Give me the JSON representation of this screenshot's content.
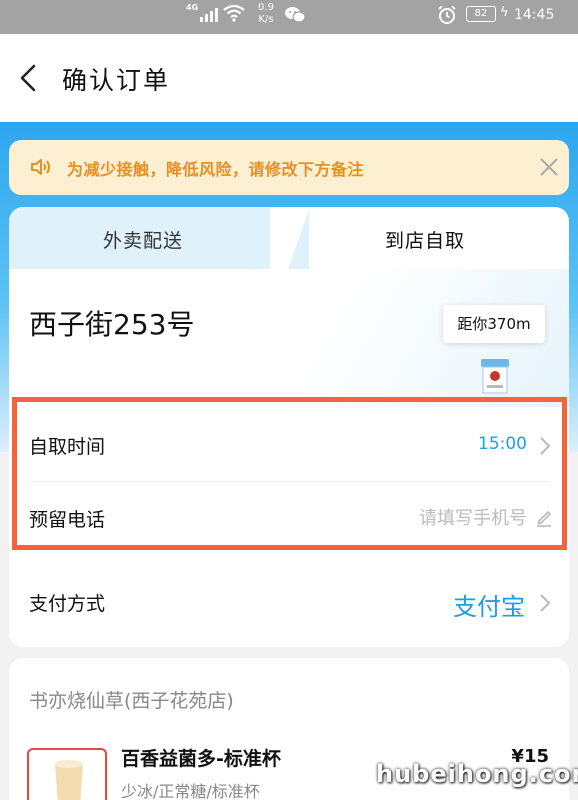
{
  "status_bar": {
    "network": "4G",
    "speed_value": "0.9",
    "speed_unit": "K/s",
    "battery": "82",
    "time": "14:45"
  },
  "header": {
    "title": "确认订单"
  },
  "notice": {
    "text": "为减少接触，降低风险，请修改下方备注"
  },
  "tabs": [
    {
      "label": "外卖配送",
      "selected": false
    },
    {
      "label": "到店自取",
      "selected": true
    }
  ],
  "pickup": {
    "address": "西子街253号",
    "distance": "距你370m"
  },
  "form": {
    "pickup_time_label": "自取时间",
    "pickup_time_value": "15:00",
    "phone_label": "预留电话",
    "phone_placeholder": "请填写手机号",
    "payment_label": "支付方式",
    "payment_value": "支付宝"
  },
  "order": {
    "store_name": "书亦烧仙草(西子花苑店)",
    "items": [
      {
        "name": "百香益菌多-标准杯",
        "spec": "少冰/正常糖/标准杯",
        "price": "¥15"
      }
    ]
  },
  "watermark": "hubeihong.com",
  "colors": {
    "accent_blue": "#1aa0e6",
    "notice_text": "#e88f20",
    "notice_bg": "#fcefd2",
    "highlight_border": "#f2643a"
  }
}
